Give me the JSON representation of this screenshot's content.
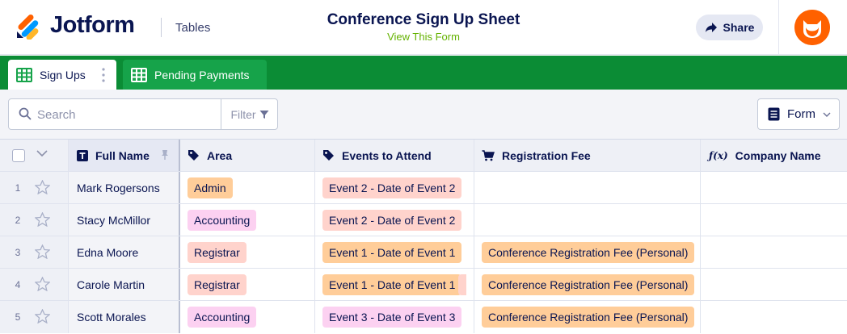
{
  "header": {
    "brand": "Jotform",
    "section": "Tables",
    "title": "Conference Sign Up Sheet",
    "subtitle": "View This Form",
    "share_label": "Share"
  },
  "tabs": [
    {
      "label": "Sign Ups",
      "active": true
    },
    {
      "label": "Pending Payments",
      "active": false
    }
  ],
  "toolbar": {
    "search_placeholder": "Search",
    "filter_label": "Filter",
    "form_label": "Form"
  },
  "columns": {
    "full_name": "Full Name",
    "area": "Area",
    "events": "Events to Attend",
    "fee": "Registration Fee",
    "company": "Company Name"
  },
  "rows": [
    {
      "num": "1",
      "name": "Mark Rogersons",
      "area": "Admin",
      "event": "Event 2 - Date of Event 2",
      "fee": ""
    },
    {
      "num": "2",
      "name": "Stacy McMillor",
      "area": "Accounting",
      "event": "Event 2 - Date of Event 2",
      "fee": ""
    },
    {
      "num": "3",
      "name": "Edna Moore",
      "area": "Registrar",
      "event": "Event 1 - Date of Event 1",
      "fee": "Conference Registration Fee (Personal)"
    },
    {
      "num": "4",
      "name": "Carole Martin",
      "area": "Registrar",
      "event": "Event 1 - Date of Event 1",
      "fee": "Conference Registration Fee (Personal)"
    },
    {
      "num": "5",
      "name": "Scott Morales",
      "area": "Accounting",
      "event": "Event 3 - Date of Event 3",
      "fee": "Conference Registration Fee (Personal)"
    }
  ],
  "colors": {
    "brand_green": "#0b8c35",
    "accent_orange": "#ff6100",
    "navy": "#0a1551"
  },
  "icons": [
    "jotform-logo-icon",
    "share-arrow-icon",
    "avatar-icon",
    "grid-icon",
    "search-icon",
    "filter-icon",
    "form-icon",
    "chevron-down-icon",
    "text-type-icon",
    "pin-icon",
    "tag-icon",
    "cart-icon",
    "formula-icon",
    "star-icon"
  ]
}
